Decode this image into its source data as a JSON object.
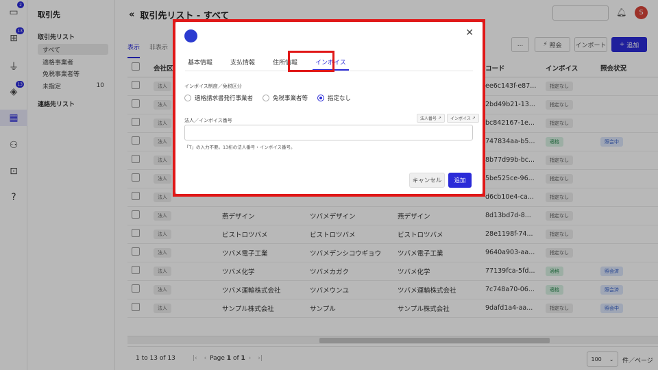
{
  "rail": {
    "badges": [
      "2",
      "13",
      "13"
    ]
  },
  "sidebar": {
    "title": "取引先",
    "section1": "取引先リスト",
    "items": [
      {
        "label": "すべて",
        "count": ""
      },
      {
        "label": "適格事業者",
        "count": ""
      },
      {
        "label": "免税事業者等",
        "count": ""
      },
      {
        "label": "未指定",
        "count": "10"
      }
    ],
    "section2": "連絡先リスト"
  },
  "header": {
    "title": "取引先リスト - すべて",
    "avatar": "S"
  },
  "tabs": [
    "表示",
    "非表示"
  ],
  "toolbar": {
    "more": "...",
    "inquiry": "照会",
    "import": "インポート",
    "add": "追加"
  },
  "table": {
    "columns": [
      "会社区",
      "",
      "",
      "コード",
      "インボイス",
      "照会状況"
    ],
    "rows": [
      {
        "tag": "法人",
        "name": "",
        "kana": "",
        "alias": "",
        "code": "ee6c143f-e87...",
        "invoice": "指定なし",
        "status": ""
      },
      {
        "tag": "法人",
        "name": "",
        "kana": "",
        "alias": "",
        "code": "2bd49b21-13...",
        "invoice": "指定なし",
        "status": ""
      },
      {
        "tag": "法人",
        "name": "",
        "kana": "",
        "alias": "",
        "code": "bc842167-1e...",
        "invoice": "指定なし",
        "status": ""
      },
      {
        "tag": "法人",
        "name": "",
        "kana": "",
        "alias": "",
        "code": "747834aa-b5...",
        "invoice": "適格",
        "status": "照会中"
      },
      {
        "tag": "法人",
        "name": "",
        "kana": "",
        "alias": "",
        "code": "8b77d99b-bc...",
        "invoice": "指定なし",
        "status": ""
      },
      {
        "tag": "法人",
        "name": "",
        "kana": "",
        "alias": "",
        "code": "5be525ce-96...",
        "invoice": "指定なし",
        "status": ""
      },
      {
        "tag": "法人",
        "name": "",
        "kana": "",
        "alias": "",
        "code": "d6cb10e4-ca...",
        "invoice": "指定なし",
        "status": ""
      },
      {
        "tag": "法人",
        "name": "燕デザイン",
        "kana": "ツバメデザイン",
        "alias": "燕デザイン",
        "code": "8d13bd7d-8...",
        "invoice": "指定なし",
        "status": ""
      },
      {
        "tag": "法人",
        "name": "ビストロツバメ",
        "kana": "ビストロツバメ",
        "alias": "ビストロツバメ",
        "code": "28e1198f-74...",
        "invoice": "指定なし",
        "status": ""
      },
      {
        "tag": "法人",
        "name": "ツバメ電子工業",
        "kana": "ツバメデンシコウギョウ",
        "alias": "ツバメ電子工業",
        "code": "9640a903-aa...",
        "invoice": "指定なし",
        "status": ""
      },
      {
        "tag": "法人",
        "name": "ツバメ化学",
        "kana": "ツバメカガク",
        "alias": "ツバメ化学",
        "code": "77139fca-5fd...",
        "invoice": "適格",
        "status": "照会済"
      },
      {
        "tag": "法人",
        "name": "ツバメ運輸株式会社",
        "kana": "ツバメウンユ",
        "alias": "ツバメ運輸株式会社",
        "code": "7c748a70-06...",
        "invoice": "適格",
        "status": "照会済"
      },
      {
        "tag": "法人",
        "name": "サンプル株式会社",
        "kana": "サンプル",
        "alias": "サンプル株式会社",
        "code": "9dafd1a4-aa...",
        "invoice": "指定なし",
        "status": "照会中"
      }
    ]
  },
  "pager": {
    "range_start": "1",
    "range_to": "to",
    "range_end": "13",
    "of_label": "of",
    "total": "13",
    "page_label": "Page",
    "page_num": "1",
    "page_of": "of",
    "page_total": "1",
    "size": "100",
    "per_page": "件／ページ"
  },
  "modal": {
    "tabs": [
      "基本情報",
      "支払情報",
      "住所情報",
      "インボイス"
    ],
    "section_label": "インボイス制度／免税区分",
    "radios": [
      "適格請求書発行事業者",
      "免税事業者等",
      "指定なし"
    ],
    "number_label": "法人／インボイス番号",
    "btn_corp": "法人番号",
    "btn_invoice": "インボイス",
    "hint": "「T」の入力不要。13桁の法人番号・インボイス番号。",
    "cancel": "キャンセル",
    "submit": "追加"
  }
}
